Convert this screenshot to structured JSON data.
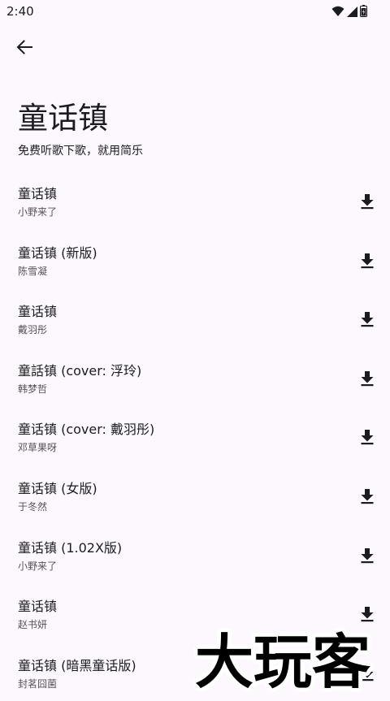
{
  "status_bar": {
    "time": "2:40",
    "icons": [
      "wifi-icon",
      "signal-icon",
      "battery-icon"
    ]
  },
  "toolbar": {
    "back_icon": "arrow-back-icon"
  },
  "header": {
    "title": "童话镇",
    "subtitle": "免费听歌下歌，就用简乐"
  },
  "songs": [
    {
      "title": "童话镇",
      "artist": "小野来了"
    },
    {
      "title": "童话镇 (新版)",
      "artist": "陈雪凝"
    },
    {
      "title": "童话镇",
      "artist": "戴羽彤"
    },
    {
      "title": "童話镇 (cover: 浮玲)",
      "artist": "韩梦哲"
    },
    {
      "title": "童话镇 (cover: 戴羽彤)",
      "artist": "邓草果呀"
    },
    {
      "title": "童话镇 (女版)",
      "artist": "于冬然"
    },
    {
      "title": "童话镇 (1.02X版)",
      "artist": "小野来了"
    },
    {
      "title": "童话镇",
      "artist": "赵书妍"
    },
    {
      "title": "童话镇 (暗黑童话版)",
      "artist": "封茗囧菌"
    }
  ],
  "download_icon": "download-icon",
  "watermark": {
    "text": "大玩客"
  },
  "colors": {
    "background": "#fdf8fd",
    "text_primary": "#1c1b1f",
    "text_secondary": "#555258"
  }
}
